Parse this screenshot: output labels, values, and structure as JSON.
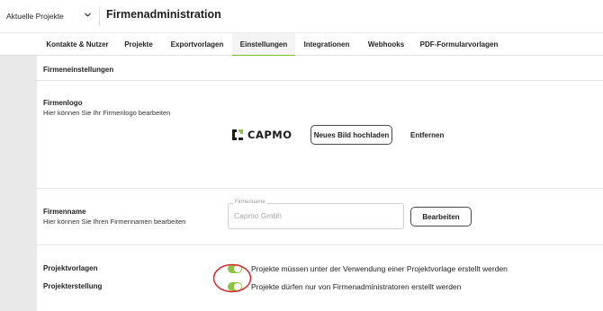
{
  "header": {
    "project_selector": "Aktuelle Projekte",
    "title": "Firmenadministration"
  },
  "tabs": [
    {
      "label": "Kontakte & Nutzer",
      "active": false
    },
    {
      "label": "Projekte",
      "active": false
    },
    {
      "label": "Exportvorlagen",
      "active": false
    },
    {
      "label": "Einstellungen",
      "active": true
    },
    {
      "label": "Integrationen",
      "active": false
    },
    {
      "label": "Webhooks",
      "active": false
    },
    {
      "label": "PDF-Formularvorlagen",
      "active": false
    }
  ],
  "settings": {
    "section_title": "Firmeneinstellungen",
    "logo": {
      "label": "Firmenlogo",
      "description": "Hier können Sie Ihr Firmenlogo bearbeiten",
      "brand_text": "CAPMO",
      "upload_button": "Neues Bild hochladen",
      "remove_button": "Entfernen"
    },
    "name": {
      "label": "Firmenname",
      "description": "Hier können Sie Ihren Firmennamen bearbeiten",
      "field_label": "Firmenname",
      "field_value": "Capmo Gmbh",
      "edit_button": "Bearbeiten"
    },
    "toggles": [
      {
        "label": "Projektvorlagen",
        "text": "Projekte müssen unter der Verwendung einer Projektvorlage erstellt werden",
        "on": true
      },
      {
        "label": "Projekterstellung",
        "text": "Projekte dürfen nur von Firmenadministratoren erstellt werden",
        "on": true
      }
    ]
  },
  "colors": {
    "accent": "#8cc63f",
    "annotation": "#d9262e"
  },
  "icons": {
    "dropdown": "chevron-down-icon",
    "brand": "capmo-logo-icon"
  }
}
